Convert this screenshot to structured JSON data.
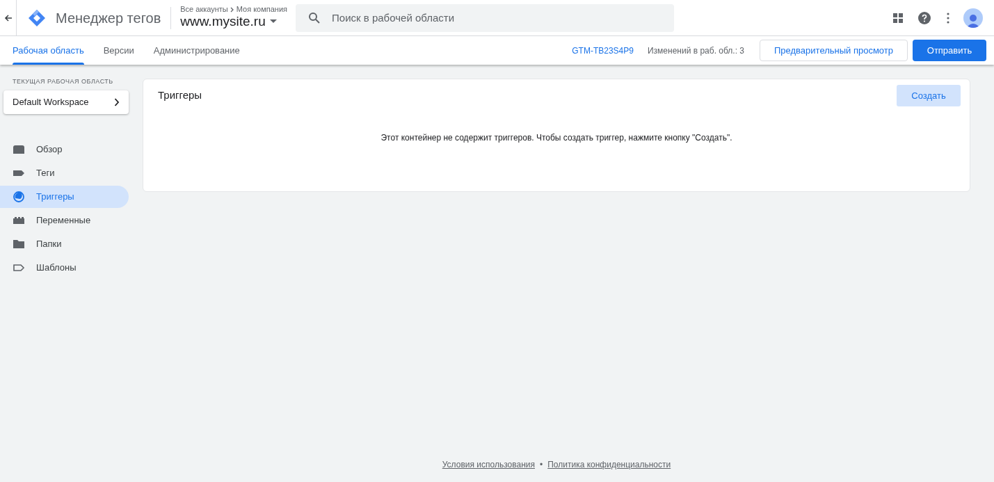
{
  "header": {
    "app_title": "Менеджер тегов",
    "breadcrumb": {
      "root": "Все аккаунты",
      "account": "Моя компания"
    },
    "container": "www.mysite.ru",
    "search": {
      "placeholder": "Поиск в рабочей области"
    }
  },
  "tabs": [
    {
      "label": "Рабочая область",
      "selected": true
    },
    {
      "label": "Версии",
      "selected": false
    },
    {
      "label": "Администрирование",
      "selected": false
    }
  ],
  "toolbar": {
    "container_id": "GTM-TB23S4P9",
    "changes": "Изменений в раб. обл.: 3",
    "preview_button": "Предварительный просмотр",
    "submit_button": "Отправить"
  },
  "sidebar": {
    "workspace_label": "ТЕКУЩАЯ РАБОЧАЯ ОБЛАСТЬ",
    "workspace": "Default Workspace",
    "items": [
      {
        "label": "Обзор",
        "kind": "overview",
        "selected": false
      },
      {
        "label": "Теги",
        "kind": "tags",
        "selected": false
      },
      {
        "label": "Триггеры",
        "kind": "triggers",
        "selected": true
      },
      {
        "label": "Переменные",
        "kind": "variables",
        "selected": false
      },
      {
        "label": "Папки",
        "kind": "folders",
        "selected": false
      },
      {
        "label": "Шаблоны",
        "kind": "templates",
        "selected": false
      }
    ]
  },
  "panel": {
    "title": "Триггеры",
    "create_button": "Создать",
    "empty_message": "Этот контейнер не содержит триггеров. Чтобы создать триггер, нажмите кнопку \"Создать\"."
  },
  "footer": {
    "links": [
      "Условия использования",
      "Политика конфиденциальности"
    ],
    "separator": "•"
  }
}
